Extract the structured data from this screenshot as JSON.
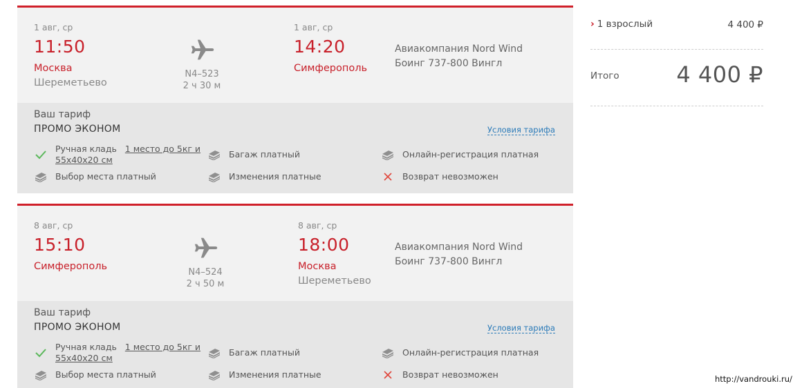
{
  "segments": [
    {
      "dep_date": "1 авг, ср",
      "dep_time": "11:50",
      "dep_city": "Москва",
      "dep_airport": "Шереметьево",
      "flight_no": "N4–523",
      "duration": "2 ч 30 м",
      "arr_date": "1 авг, ср",
      "arr_time": "14:20",
      "arr_city": "Симферополь",
      "arr_airport": "",
      "airline": "Авиакомпания Nord Wind",
      "aircraft": "Боинг 737-800 Вингл",
      "tariff_label": "Ваш тариф",
      "tariff_name": "ПРОМО ЭКОНОМ",
      "tariff_link": "Условия тарифа",
      "features": {
        "hand_luggage_prefix": "Ручная кладь",
        "hand_luggage_link1": "1 место до 5кг и",
        "hand_luggage_link2": "55х40х20 см",
        "baggage": "Багаж платный",
        "checkin": "Онлайн-регистрация платная",
        "seat": "Выбор места платный",
        "changes": "Изменения платные",
        "refund": "Возврат невозможен"
      }
    },
    {
      "dep_date": "8 авг, ср",
      "dep_time": "15:10",
      "dep_city": "Симферополь",
      "dep_airport": "",
      "flight_no": "N4–524",
      "duration": "2 ч 50 м",
      "arr_date": "8 авг, ср",
      "arr_time": "18:00",
      "arr_city": "Москва",
      "arr_airport": "Шереметьево",
      "airline": "Авиакомпания Nord Wind",
      "aircraft": "Боинг 737-800 Вингл",
      "tariff_label": "Ваш тариф",
      "tariff_name": "ПРОМО ЭКОНОМ",
      "tariff_link": "Условия тарифа",
      "features": {
        "hand_luggage_prefix": "Ручная кладь",
        "hand_luggage_link1": "1 место до 5кг и",
        "hand_luggage_link2": "55х40х20 см",
        "baggage": "Багаж платный",
        "checkin": "Онлайн-регистрация платная",
        "seat": "Выбор места платный",
        "changes": "Изменения платные",
        "refund": "Возврат невозможен"
      }
    }
  ],
  "summary": {
    "passengers": "1 взрослый",
    "passenger_price": "4 400 ₽",
    "total_label": "Итого",
    "total_value": "4 400 ₽"
  },
  "watermark": "http://vandrouki.ru/",
  "icons": {
    "plane": "plane-icon",
    "included": "checkmark-icon",
    "paid": "money-stack-icon",
    "unavailable": "cross-icon",
    "expand": "chevron-right-icon"
  },
  "colors": {
    "accent": "#c8202a",
    "link": "#2a7ab8",
    "check": "#5cb85c",
    "cross": "#e0453a"
  }
}
